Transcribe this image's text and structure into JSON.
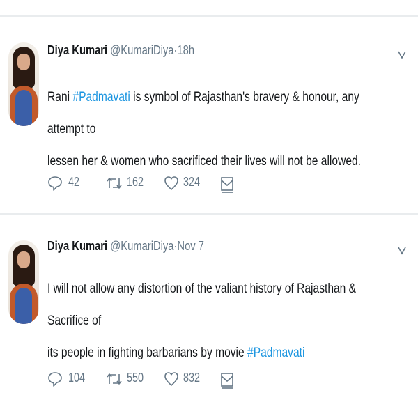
{
  "tweets": [
    {
      "name": "Diya Kumari",
      "handle": "@KumariDiya",
      "separator": "·",
      "time": "18h",
      "line1_pre": "Rani ",
      "line1_tag": "#Padmavati",
      "line1_post": " is symbol of Rajasthan's bravery & honour, any attempt to",
      "line2": "lessen her & women who sacrificed their lives will not be allowed.",
      "replies": "42",
      "retweets": "162",
      "likes": "324",
      "icons": [
        "reply-icon",
        "retweet-icon",
        "like-icon",
        "message-icon",
        "chevron-down-icon"
      ]
    },
    {
      "name": "Diya Kumari",
      "handle": "@KumariDiya",
      "separator": "·",
      "time": "Nov 7",
      "line1": "I will not allow any distortion of the valiant history of Rajasthan & Sacrifice of",
      "line2_pre": "its people in fighting barbarians by movie ",
      "line2_tag": "#Padmavati",
      "replies": "104",
      "retweets": "550",
      "likes": "832",
      "icons": [
        "reply-icon",
        "retweet-icon",
        "like-icon",
        "message-icon",
        "chevron-down-icon"
      ]
    }
  ],
  "colors": {
    "hashtag": "#1b95e0",
    "muted": "#657786",
    "text": "#14171a",
    "separator_bg": "#e9ecee"
  }
}
